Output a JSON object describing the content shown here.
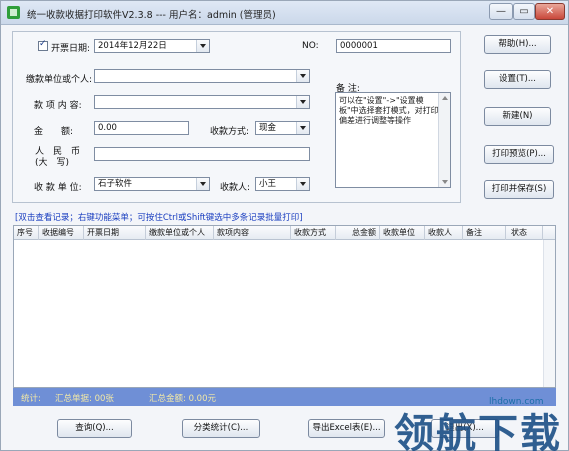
{
  "window": {
    "title": "统一收款收据打印软件V2.3.8 --- 用户名：admin (管理员)",
    "min_label": "—",
    "max_label": "▭",
    "close_label": "✕"
  },
  "form": {
    "date_label": "开票日期:",
    "date_value": "2014年12月22日",
    "no_label": "NO:",
    "no_value": "0000001",
    "payer_label": "缴款单位或个人:",
    "payer_value": "",
    "item_label": "款 项 内 容:",
    "item_value": "",
    "amount_label": "金　　额:",
    "amount_value": "0.00",
    "pay_method_label": "收款方式:",
    "pay_method_value": "现金",
    "rmb_label_1": "人　民　币",
    "rmb_label_2": "(大　写)",
    "rmb_value": "",
    "payee_unit_label": "收 款 单 位:",
    "payee_unit_value": "石子软件",
    "payee_label": "收款人:",
    "payee_value": "小王",
    "remark_label": "备 注:",
    "remark_text": "可以在\"设置\"->\"设置模板\"中选择套打模式，对打印偏差进行调整等操作"
  },
  "side_buttons": {
    "help": "帮助(H)...",
    "settings": "设置(T)...",
    "new": "新建(N)",
    "preview": "打印预览(P)...",
    "print_save": "打印并保存(S)"
  },
  "hint": "[双击查看记录；右键功能菜单；可按住Ctrl或Shift键选中多条记录批量打印]",
  "grid": {
    "columns": [
      "序号",
      "收据编号",
      "开票日期",
      "缴款单位或个人",
      "款项内容",
      "收款方式",
      "总金额",
      "收款单位",
      "收款人",
      "备注",
      "状态"
    ]
  },
  "status": {
    "label": "统计:",
    "count": "汇总单据: 00张",
    "amount": "汇总金额: 0.00元"
  },
  "bottom_buttons": {
    "query": "查询(Q)...",
    "category_stats": "分类统计(C)...",
    "export_excel": "导出Excel表(E)...",
    "quit": "退出(X)..."
  },
  "watermark": {
    "url": "lhdown.com",
    "text": "领航下载"
  }
}
